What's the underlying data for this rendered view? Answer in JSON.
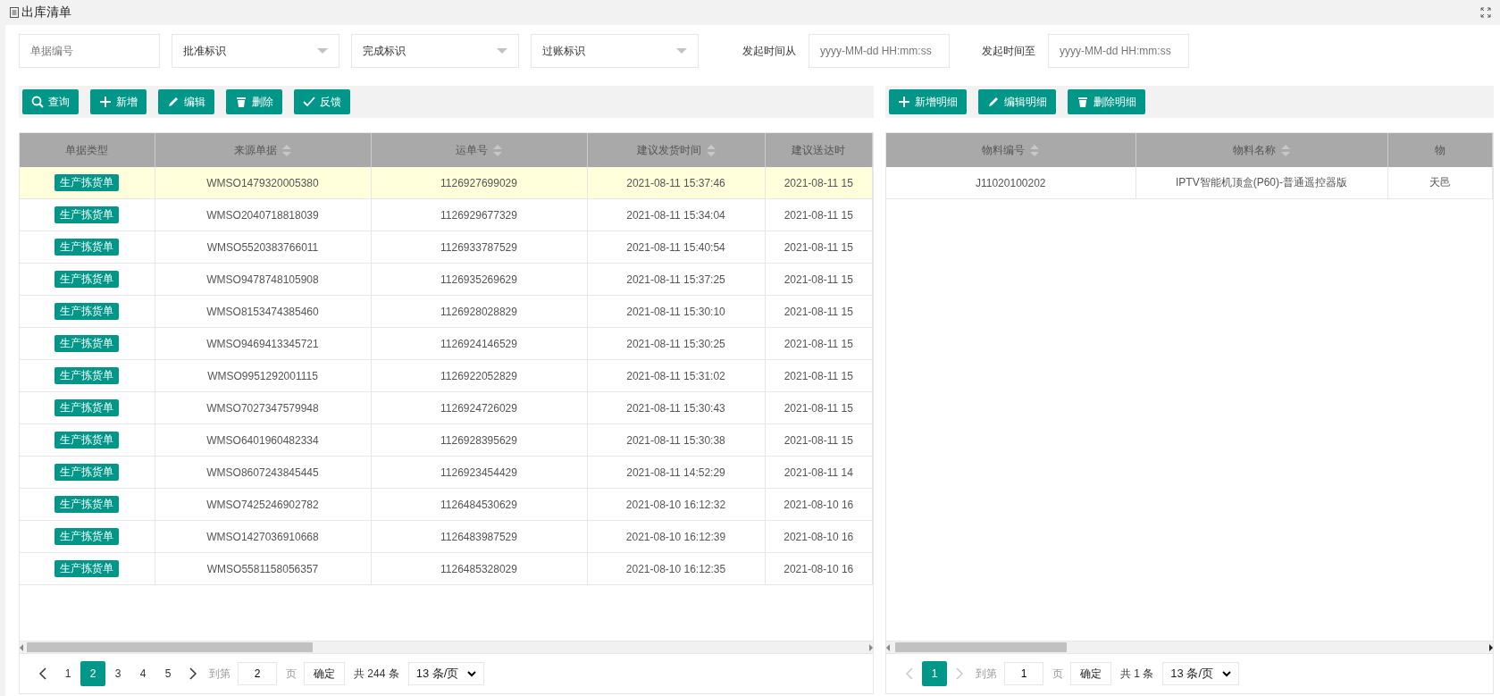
{
  "window": {
    "title": "出库清单"
  },
  "filters": [
    {
      "kind": "input",
      "placeholder": "单据编号"
    },
    {
      "kind": "select",
      "value": "批准标识"
    },
    {
      "kind": "select",
      "value": "完成标识"
    },
    {
      "kind": "select",
      "value": "过账标识"
    },
    {
      "kind": "date",
      "label": "发起时间从",
      "placeholder": "yyyy-MM-dd HH:mm:ss"
    },
    {
      "kind": "date",
      "label": "发起时间至",
      "placeholder": "yyyy-MM-dd HH:mm:ss"
    }
  ],
  "left": {
    "toolbar": [
      {
        "kind": "search",
        "label": "查询"
      },
      {
        "kind": "add",
        "label": "新增"
      },
      {
        "kind": "edit",
        "label": "编辑"
      },
      {
        "kind": "delete",
        "label": "删除"
      },
      {
        "kind": "confirm",
        "label": "反馈"
      }
    ],
    "table": {
      "columns": [
        {
          "label": "单据类型",
          "sortable": false
        },
        {
          "label": "来源单据",
          "sortable": true
        },
        {
          "label": "运单号",
          "sortable": true
        },
        {
          "label": "建议发货时间",
          "sortable": true
        },
        {
          "label": "建议送达时",
          "sortable": false
        }
      ],
      "rows": [
        {
          "selected": true,
          "cells": [
            {
              "kind": "badge",
              "text": "生产拣货单"
            },
            {
              "kind": "text",
              "text": "WMSO1479320005380"
            },
            {
              "kind": "text",
              "text": "1126927699029"
            },
            {
              "kind": "text",
              "text": "2021-08-11 15:37:46"
            },
            {
              "kind": "text",
              "text": "2021-08-11 15"
            }
          ]
        },
        {
          "selected": false,
          "cells": [
            {
              "kind": "badge",
              "text": "生产拣货单"
            },
            {
              "kind": "text",
              "text": "WMSO2040718818039"
            },
            {
              "kind": "text",
              "text": "1126929677329"
            },
            {
              "kind": "text",
              "text": "2021-08-11 15:34:04"
            },
            {
              "kind": "text",
              "text": "2021-08-11 15"
            }
          ]
        },
        {
          "selected": false,
          "cells": [
            {
              "kind": "badge",
              "text": "生产拣货单"
            },
            {
              "kind": "text",
              "text": "WMSO5520383766011"
            },
            {
              "kind": "text",
              "text": "1126933787529"
            },
            {
              "kind": "text",
              "text": "2021-08-11 15:40:54"
            },
            {
              "kind": "text",
              "text": "2021-08-11 15"
            }
          ]
        },
        {
          "selected": false,
          "cells": [
            {
              "kind": "badge",
              "text": "生产拣货单"
            },
            {
              "kind": "text",
              "text": "WMSO9478748105908"
            },
            {
              "kind": "text",
              "text": "1126935269629"
            },
            {
              "kind": "text",
              "text": "2021-08-11 15:37:25"
            },
            {
              "kind": "text",
              "text": "2021-08-11 15"
            }
          ]
        },
        {
          "selected": false,
          "cells": [
            {
              "kind": "badge",
              "text": "生产拣货单"
            },
            {
              "kind": "text",
              "text": "WMSO8153474385460"
            },
            {
              "kind": "text",
              "text": "1126928028829"
            },
            {
              "kind": "text",
              "text": "2021-08-11 15:30:10"
            },
            {
              "kind": "text",
              "text": "2021-08-11 15"
            }
          ]
        },
        {
          "selected": false,
          "cells": [
            {
              "kind": "badge",
              "text": "生产拣货单"
            },
            {
              "kind": "text",
              "text": "WMSO9469413345721"
            },
            {
              "kind": "text",
              "text": "1126924146529"
            },
            {
              "kind": "text",
              "text": "2021-08-11 15:30:25"
            },
            {
              "kind": "text",
              "text": "2021-08-11 15"
            }
          ]
        },
        {
          "selected": false,
          "cells": [
            {
              "kind": "badge",
              "text": "生产拣货单"
            },
            {
              "kind": "text",
              "text": "WMSO9951292001115"
            },
            {
              "kind": "text",
              "text": "1126922052829"
            },
            {
              "kind": "text",
              "text": "2021-08-11 15:31:02"
            },
            {
              "kind": "text",
              "text": "2021-08-11 15"
            }
          ]
        },
        {
          "selected": false,
          "cells": [
            {
              "kind": "badge",
              "text": "生产拣货单"
            },
            {
              "kind": "text",
              "text": "WMSO7027347579948"
            },
            {
              "kind": "text",
              "text": "1126924726029"
            },
            {
              "kind": "text",
              "text": "2021-08-11 15:30:43"
            },
            {
              "kind": "text",
              "text": "2021-08-11 15"
            }
          ]
        },
        {
          "selected": false,
          "cells": [
            {
              "kind": "badge",
              "text": "生产拣货单"
            },
            {
              "kind": "text",
              "text": "WMSO6401960482334"
            },
            {
              "kind": "text",
              "text": "1126928395629"
            },
            {
              "kind": "text",
              "text": "2021-08-11 15:30:38"
            },
            {
              "kind": "text",
              "text": "2021-08-11 15"
            }
          ]
        },
        {
          "selected": false,
          "cells": [
            {
              "kind": "badge",
              "text": "生产拣货单"
            },
            {
              "kind": "text",
              "text": "WMSO8607243845445"
            },
            {
              "kind": "text",
              "text": "1126923454429"
            },
            {
              "kind": "text",
              "text": "2021-08-11 14:52:29"
            },
            {
              "kind": "text",
              "text": "2021-08-11 14"
            }
          ]
        },
        {
          "selected": false,
          "cells": [
            {
              "kind": "badge",
              "text": "生产拣货单"
            },
            {
              "kind": "text",
              "text": "WMSO7425246902782"
            },
            {
              "kind": "text",
              "text": "1126484530629"
            },
            {
              "kind": "text",
              "text": "2021-08-10 16:12:32"
            },
            {
              "kind": "text",
              "text": "2021-08-10 16"
            }
          ]
        },
        {
          "selected": false,
          "cells": [
            {
              "kind": "badge",
              "text": "生产拣货单"
            },
            {
              "kind": "text",
              "text": "WMSO1427036910668"
            },
            {
              "kind": "text",
              "text": "1126483987529"
            },
            {
              "kind": "text",
              "text": "2021-08-10 16:12:39"
            },
            {
              "kind": "text",
              "text": "2021-08-10 16"
            }
          ]
        },
        {
          "selected": false,
          "cells": [
            {
              "kind": "badge",
              "text": "生产拣货单"
            },
            {
              "kind": "text",
              "text": "WMSO5581158056357"
            },
            {
              "kind": "text",
              "text": "1126485328029"
            },
            {
              "kind": "text",
              "text": "2021-08-10 16:12:35"
            },
            {
              "kind": "text",
              "text": "2021-08-10 16"
            }
          ]
        }
      ]
    },
    "pagination": {
      "prev": {
        "disabled": false
      },
      "pages": [
        {
          "label": "1",
          "selected": false
        },
        {
          "label": "2",
          "selected": true
        },
        {
          "label": "3",
          "selected": false
        },
        {
          "label": "4",
          "selected": false
        },
        {
          "label": "5",
          "selected": false
        }
      ],
      "next": {
        "disabled": false
      },
      "goto_label": "到第",
      "goto_value": "2",
      "page_unit": "页",
      "confirm": "确定",
      "total": "共 244 条",
      "page_size": "13 条/页"
    }
  },
  "right": {
    "toolbar": [
      {
        "kind": "add",
        "label": "新增明细"
      },
      {
        "kind": "edit",
        "label": "编辑明细"
      },
      {
        "kind": "delete",
        "label": "删除明细"
      }
    ],
    "table": {
      "columns": [
        {
          "label": "物料编号",
          "sortable": true
        },
        {
          "label": "物料名称",
          "sortable": true
        },
        {
          "label": "物",
          "sortable": false
        }
      ],
      "rows": [
        {
          "selected": false,
          "cells": [
            {
              "kind": "text",
              "text": "J11020100202"
            },
            {
              "kind": "text",
              "text": "IPTV智能机顶盒(P60)-普通遥控器版"
            },
            {
              "kind": "text",
              "text": "天邑"
            }
          ]
        }
      ]
    },
    "pagination": {
      "prev": {
        "disabled": true
      },
      "pages": [
        {
          "label": "1",
          "selected": true
        }
      ],
      "next": {
        "disabled": true
      },
      "goto_label": "到第",
      "goto_value": "1",
      "page_unit": "页",
      "confirm": "确定",
      "total": "共 1 条",
      "page_size": "13 条/页"
    }
  }
}
